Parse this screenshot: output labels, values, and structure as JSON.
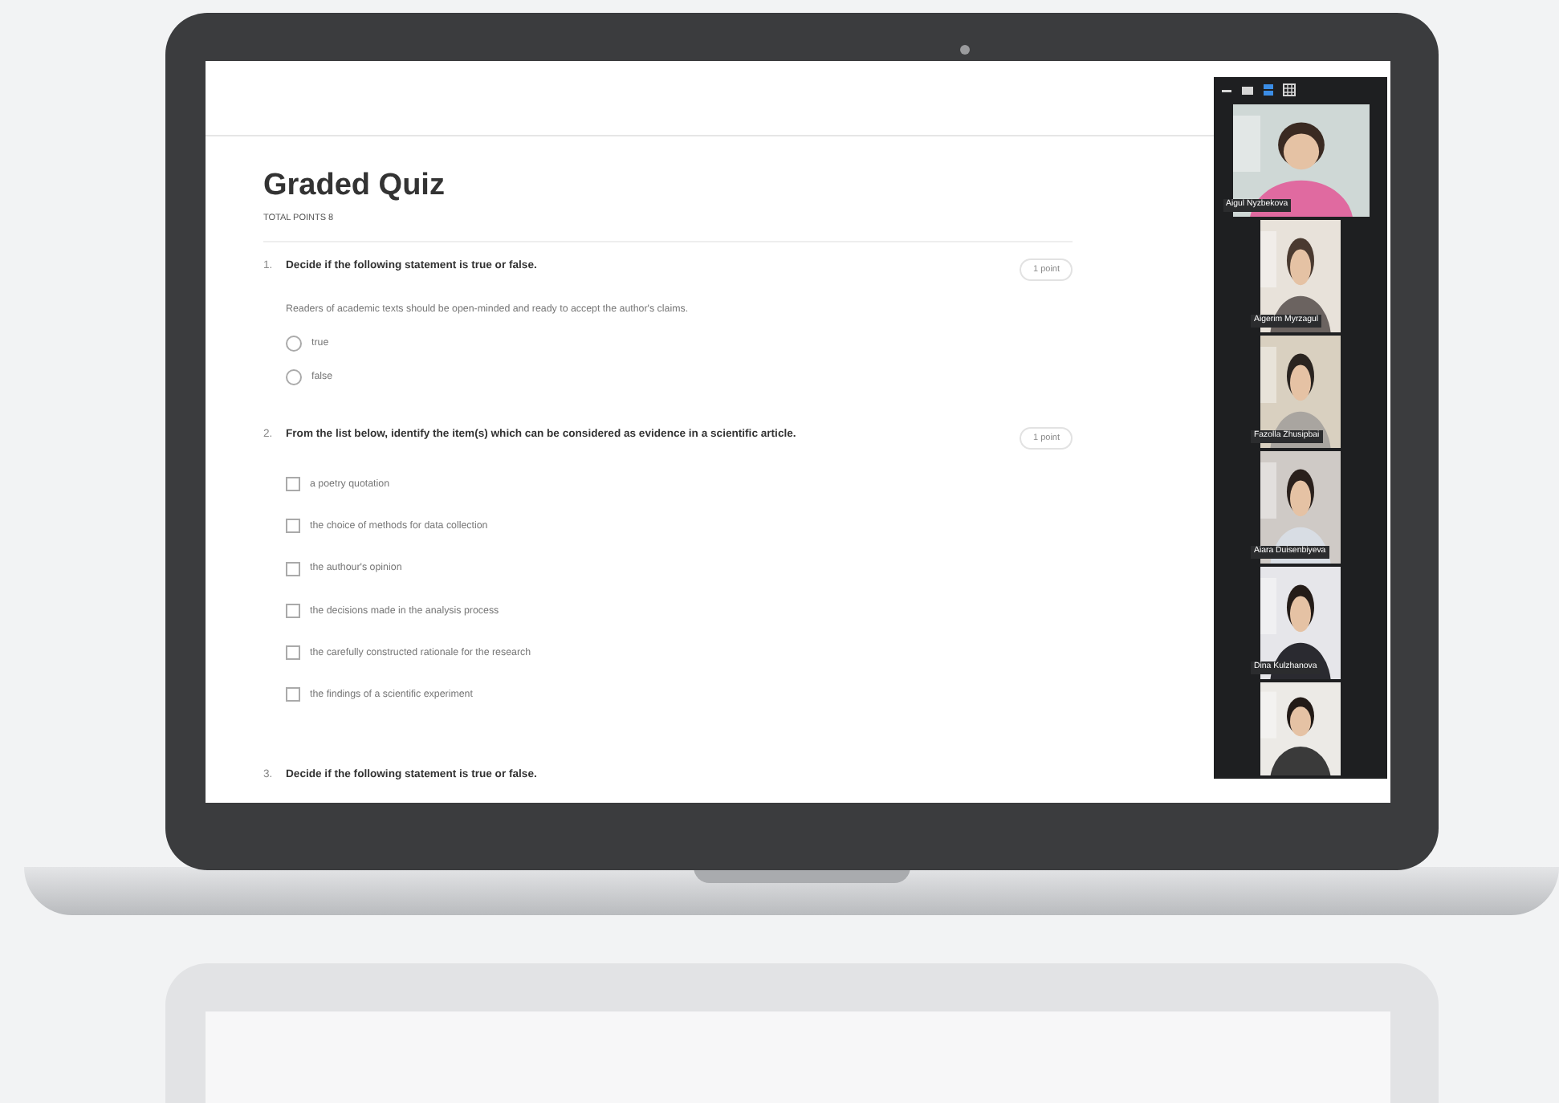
{
  "quiz": {
    "title": "Graded Quiz",
    "total_points": "TOTAL POINTS 8",
    "questions": [
      {
        "number": "1.",
        "text": "Decide if the following statement is true or false.",
        "points": "1 point",
        "statement": "Readers of academic texts should be open-minded and ready to accept the author's claims.",
        "options": [
          {
            "kind": "radio",
            "label": "true",
            "checked": false
          },
          {
            "kind": "radio",
            "label": "false",
            "checked": false
          }
        ]
      },
      {
        "number": "2.",
        "text": "From the list below, identify the item(s) which can be considered as evidence in a scientific article.",
        "points": "1 point",
        "options": [
          {
            "kind": "checkbox",
            "label": "a poetry quotation",
            "checked": false
          },
          {
            "kind": "checkbox",
            "label": "the choice of methods for data collection",
            "checked": false
          },
          {
            "kind": "checkbox",
            "label": "the authour's opinion",
            "checked": false
          },
          {
            "kind": "checkbox",
            "label": "the decisions made in the analysis process",
            "checked": false
          },
          {
            "kind": "checkbox",
            "label": "the carefully constructed rationale for the research",
            "checked": false
          },
          {
            "kind": "checkbox",
            "label": "the findings of a scientific experiment",
            "checked": false
          }
        ]
      },
      {
        "number": "3.",
        "text": "Decide if the following statement is true or false."
      }
    ]
  },
  "video_panel": {
    "view_buttons": [
      {
        "kind": "minimize",
        "selected": false
      },
      {
        "kind": "thumbnail",
        "selected": false
      },
      {
        "kind": "speaker",
        "selected": true
      },
      {
        "kind": "gallery",
        "selected": false
      }
    ],
    "participants": [
      {
        "name": "Aigul Nyzbekova",
        "wide": true
      },
      {
        "name": "Aigerim Myrzagul",
        "wide": false
      },
      {
        "name": "Fazolla Zhusipbai",
        "wide": false
      },
      {
        "name": "Aiara Duisenbiyeva",
        "wide": false
      },
      {
        "name": "Dina Kulzhanova",
        "wide": false
      },
      {
        "wide": false
      }
    ]
  }
}
